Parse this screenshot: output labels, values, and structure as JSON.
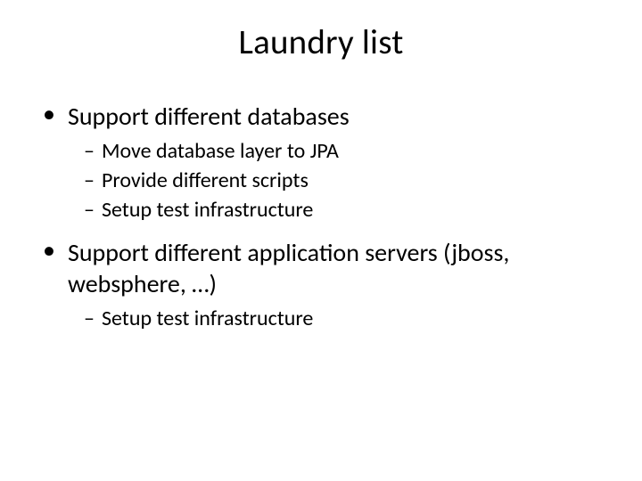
{
  "slide": {
    "title": "Laundry list",
    "items": [
      {
        "text": "Support different databases",
        "subitems": [
          "Move database layer to JPA",
          "Provide different scripts",
          "Setup test infrastructure"
        ]
      },
      {
        "text": "Support different application servers (jboss, websphere, …)",
        "subitems": [
          "Setup test infrastructure"
        ]
      }
    ]
  }
}
